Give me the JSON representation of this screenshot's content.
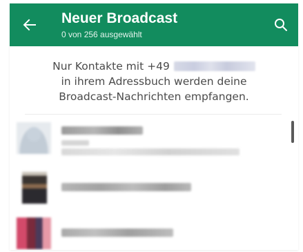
{
  "toolbar": {
    "title": "Neuer Broadcast",
    "subtitle": "0 von 256 ausgewählt",
    "back_icon": "arrow-left-icon",
    "search_icon": "search-icon",
    "color": "#128c5e"
  },
  "info": {
    "line1_prefix": "Nur Kontakte mit +49",
    "line2": "in ihrem Adressbuch werden deine",
    "line3": "Broadcast-Nachrichten empfangen."
  }
}
